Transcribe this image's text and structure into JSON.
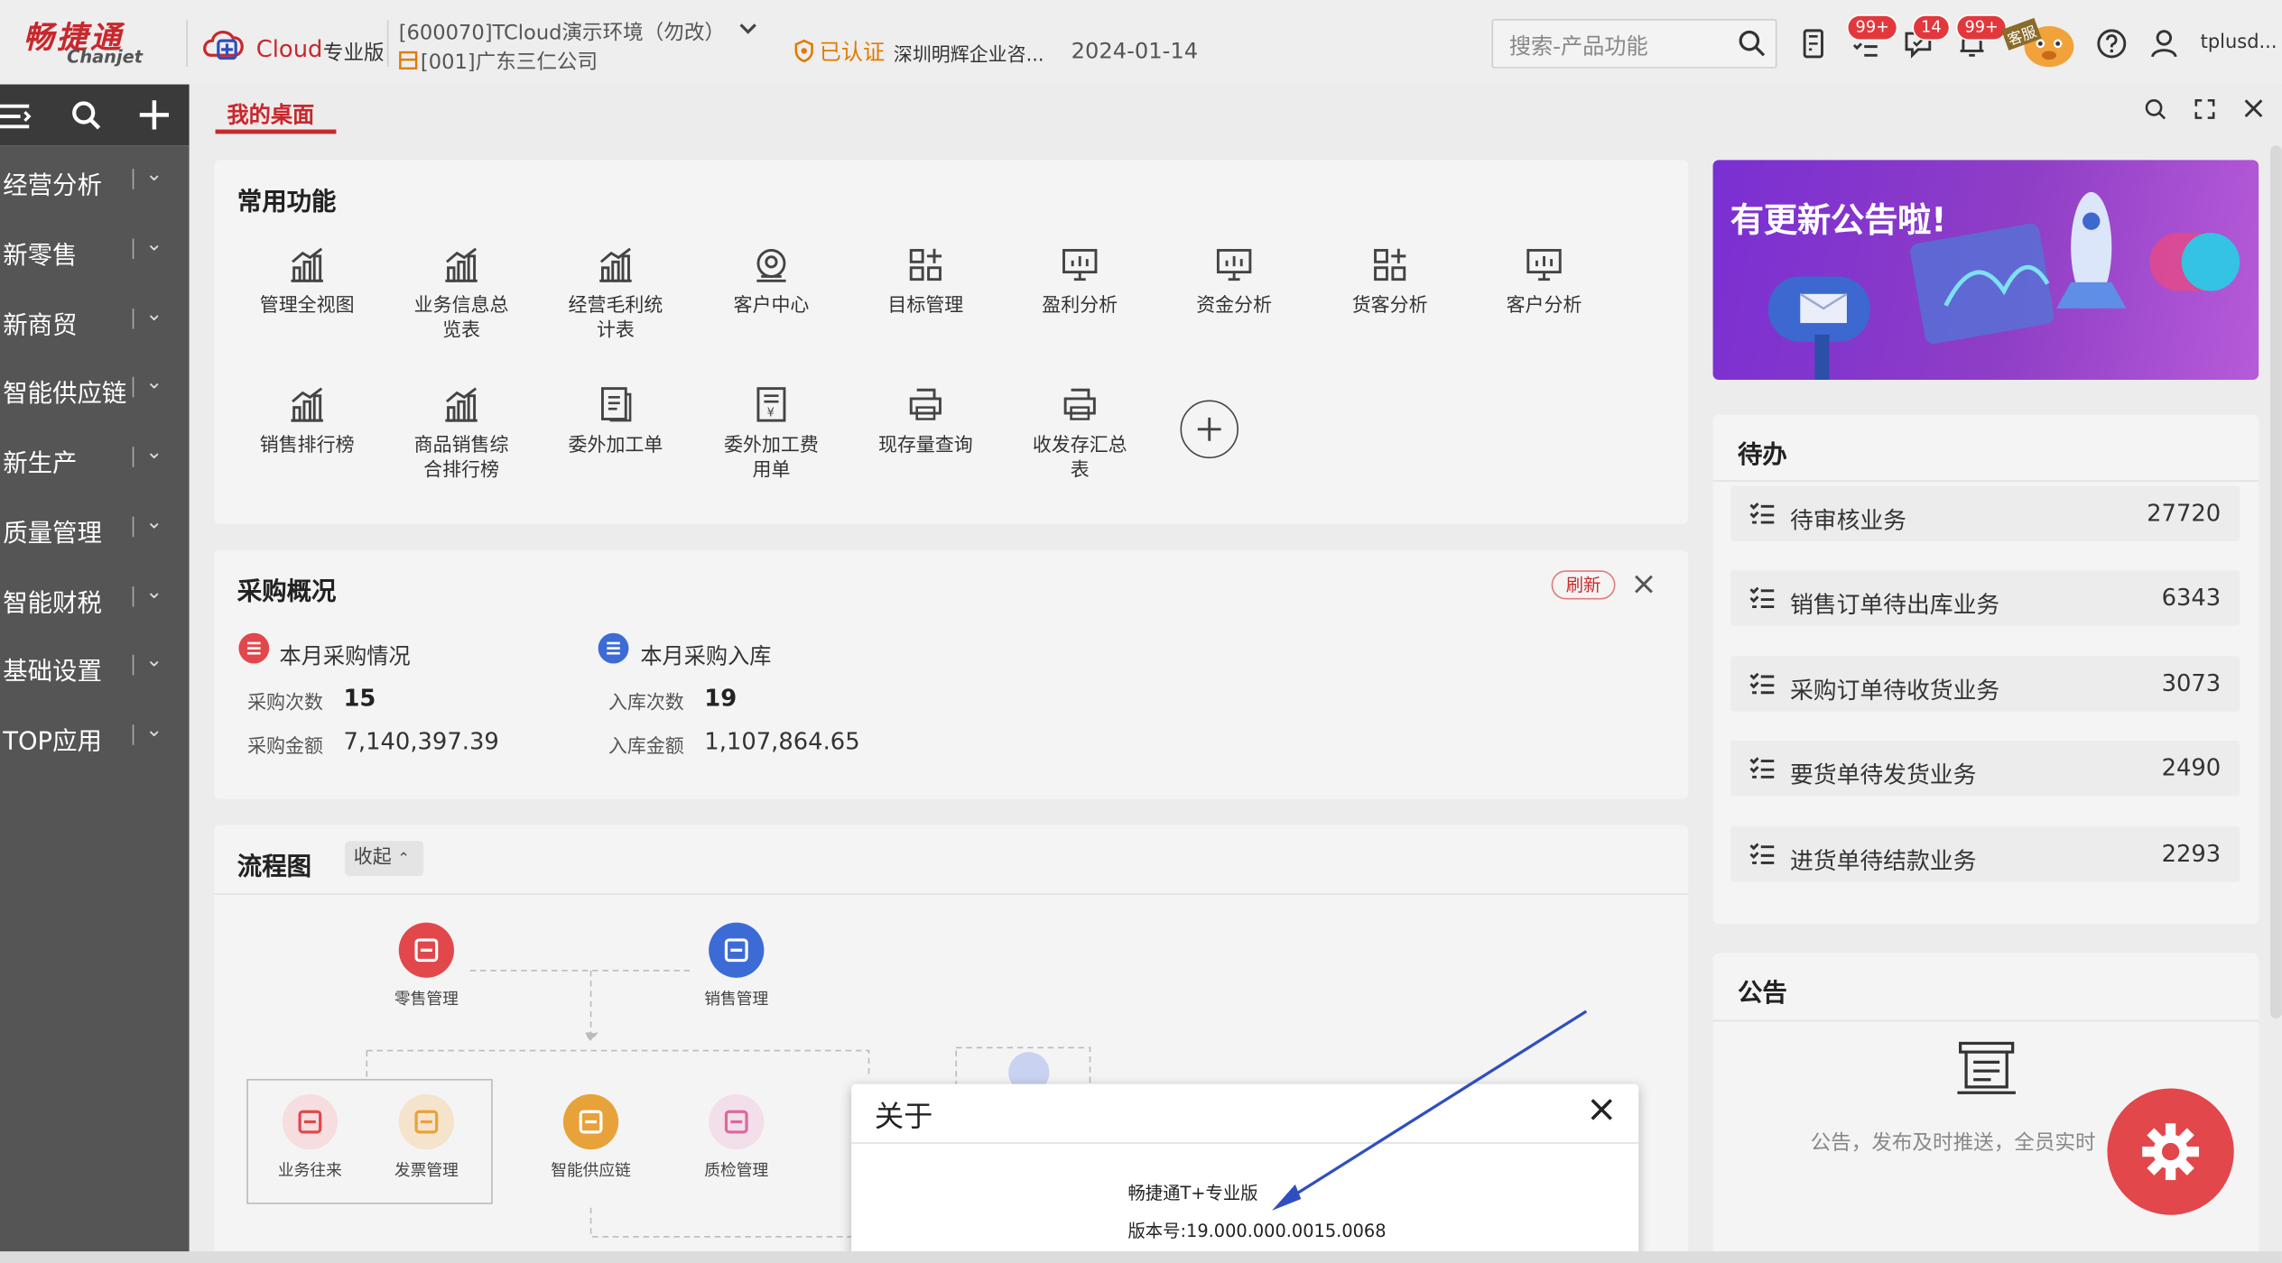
{
  "header": {
    "logo_cn": "畅捷通",
    "logo_en": "Chanjet",
    "product_name": "Cloud",
    "product_edition": "专业版",
    "environment": "[600070]TCloud演示环境（勿改）",
    "organization": "[001]广东三仁公司",
    "certified": "已认证",
    "company": "深圳明辉企业咨...",
    "date": "2024-01-14",
    "search_placeholder": "搜索-产品功能",
    "badges": {
      "approvals": "99+",
      "messages": "14",
      "notices": "99+"
    },
    "service_label": "客服",
    "username": "tplusd..."
  },
  "tabs": {
    "active_label": "我的桌面"
  },
  "sidebar": {
    "items": [
      {
        "label": "经营分析"
      },
      {
        "label": "新零售"
      },
      {
        "label": "新商贸"
      },
      {
        "label": "智能供应链"
      },
      {
        "label": "新生产"
      },
      {
        "label": "质量管理"
      },
      {
        "label": "智能财税"
      },
      {
        "label": "基础设置"
      },
      {
        "label": "TOP应用"
      }
    ]
  },
  "common_functions": {
    "title": "常用功能",
    "items": [
      {
        "label": "管理全视图",
        "icon": "chart-line-icon"
      },
      {
        "label": "业务信息总览表",
        "icon": "chart-line-icon"
      },
      {
        "label": "经营毛利统计表",
        "icon": "chart-line-icon"
      },
      {
        "label": "客户中心",
        "icon": "customer-center-icon"
      },
      {
        "label": "目标管理",
        "icon": "grid-plus-icon"
      },
      {
        "label": "盈利分析",
        "icon": "monitor-chart-icon"
      },
      {
        "label": "资金分析",
        "icon": "monitor-chart-icon"
      },
      {
        "label": "货客分析",
        "icon": "grid-plus-icon"
      },
      {
        "label": "客户分析",
        "icon": "monitor-chart-icon"
      },
      {
        "label": "销售排行榜",
        "icon": "chart-line-icon"
      },
      {
        "label": "商品销售综合排行榜",
        "icon": "chart-line-icon"
      },
      {
        "label": "委外加工单",
        "icon": "document-icon"
      },
      {
        "label": "委外加工费用单",
        "icon": "receipt-icon"
      },
      {
        "label": "现存量查询",
        "icon": "printer-icon"
      },
      {
        "label": "收发存汇总表",
        "icon": "printer-icon"
      }
    ]
  },
  "purchase": {
    "title": "采购概况",
    "refresh_label": "刷新",
    "left": {
      "title": "本月采购情况",
      "count_label": "采购次数",
      "count_value": "15",
      "amount_label": "采购金额",
      "amount_value": "7,140,397.39"
    },
    "right": {
      "title": "本月采购入库",
      "count_label": "入库次数",
      "count_value": "19",
      "amount_label": "入库金额",
      "amount_value": "1,107,864.65"
    }
  },
  "flow": {
    "title": "流程图",
    "collapse_label": "收起",
    "nodes": [
      {
        "label": "零售管理",
        "color": "#e2474b"
      },
      {
        "label": "销售管理",
        "color": "#3d6bd6"
      },
      {
        "label": "业务往来",
        "color": "#e2474b"
      },
      {
        "label": "发票管理",
        "color": "#e8a23a"
      },
      {
        "label": "智能供应链",
        "color": "#e8a23a"
      },
      {
        "label": "质检管理",
        "color": "#d96aa0"
      }
    ]
  },
  "banner": {
    "text": "有更新公告啦!"
  },
  "todo": {
    "title": "待办",
    "items": [
      {
        "label": "待审核业务",
        "count": "27720"
      },
      {
        "label": "销售订单待出库业务",
        "count": "6343"
      },
      {
        "label": "采购订单待收货业务",
        "count": "3073"
      },
      {
        "label": "要货单待发货业务",
        "count": "2490"
      },
      {
        "label": "进货单待结款业务",
        "count": "2293"
      }
    ]
  },
  "notice": {
    "title": "公告",
    "empty_text": "公告，发布及时推送，全员实时"
  },
  "about_dialog": {
    "title": "关于",
    "product": "畅捷通T+专业版",
    "version": "版本号:19.000.000.0015.0068"
  },
  "colors": {
    "brand": "#c8282d",
    "sidebar": "#555555",
    "fab": "#e2474b",
    "arrow": "#2f4fbf"
  }
}
